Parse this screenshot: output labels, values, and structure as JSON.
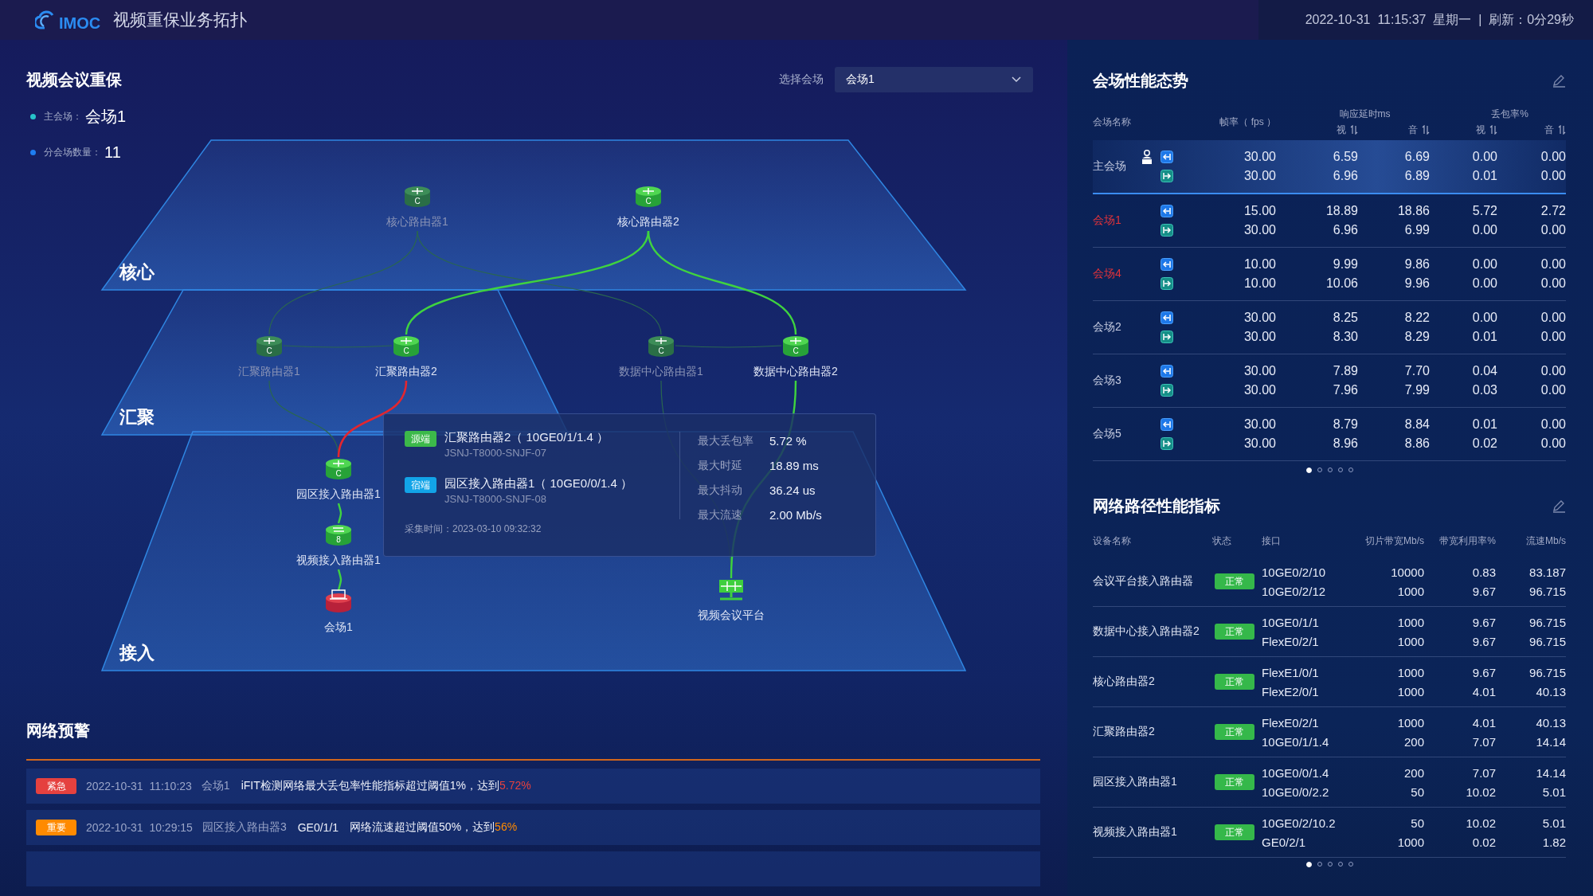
{
  "header": {
    "logo": "IMOC",
    "title": "视频重保业务拓扑",
    "datetime": "2022-10-31  11:15:37  星期一  |  刷新：0分29秒"
  },
  "venue": {
    "title": "视频会议重保",
    "select_label": "选择会场",
    "select_value": "会场1",
    "main_label": "主会场：",
    "main_value": "会场1",
    "count_label": "分会场数量：",
    "count_value": "11"
  },
  "topology": {
    "layers": [
      {
        "name": "核心"
      },
      {
        "name": "汇聚"
      },
      {
        "name": "接入"
      }
    ],
    "nodes": [
      {
        "label": "核心路由器1",
        "kind": "router",
        "badge": "C",
        "highlighted": false
      },
      {
        "label": "核心路由器2",
        "kind": "router",
        "badge": "C",
        "highlighted": true
      },
      {
        "label": "汇聚路由器1",
        "kind": "router",
        "badge": "C",
        "highlighted": false
      },
      {
        "label": "汇聚路由器2",
        "kind": "router",
        "badge": "C",
        "highlighted": true
      },
      {
        "label": "数据中心路由器1",
        "kind": "router",
        "badge": "C",
        "highlighted": false
      },
      {
        "label": "数据中心路由器2",
        "kind": "router",
        "badge": "C",
        "highlighted": true
      },
      {
        "label": "园区接入路由器1",
        "kind": "router",
        "badge": "C",
        "highlighted": true
      },
      {
        "label": "视频接入路由器1",
        "kind": "switch",
        "badge": "8",
        "highlighted": true
      },
      {
        "label": "会场1",
        "kind": "venue",
        "highlighted": true
      },
      {
        "label": "视频会议平台",
        "kind": "platform",
        "highlighted": true
      }
    ],
    "links": [
      {
        "highlighted": false,
        "alarm": false
      },
      {
        "highlighted": false,
        "alarm": false
      },
      {
        "highlighted": true,
        "alarm": false
      },
      {
        "highlighted": true,
        "alarm": false
      },
      {
        "highlighted": false,
        "alarm": false
      },
      {
        "highlighted": false,
        "alarm": false
      },
      {
        "highlighted": false,
        "alarm": false
      },
      {
        "highlighted": true,
        "alarm": true
      },
      {
        "highlighted": true,
        "alarm": false
      },
      {
        "highlighted": true,
        "alarm": false
      },
      {
        "highlighted": false,
        "alarm": false
      },
      {
        "highlighted": true,
        "alarm": false
      }
    ],
    "tooltip": {
      "endpoints": [
        {
          "kind": "source",
          "tag": "源端",
          "name": "汇聚路由器2（ 10GE0/1/1.4 ）",
          "device": "JSNJ-T8000-SNJF-07"
        },
        {
          "kind": "sink",
          "tag": "宿端",
          "name": "园区接入路由器1（ 10GE0/0/1.4 ）",
          "device": "JSNJ-T8000-SNJF-08"
        }
      ],
      "time": "采集时间：2023-03-10 09:32:32",
      "metrics": [
        {
          "label": "最大丢包率",
          "value": "5.72 %"
        },
        {
          "label": "最大时延",
          "value": "18.89 ms"
        },
        {
          "label": "最大抖动",
          "value": "36.24 us"
        },
        {
          "label": "最大流速",
          "value": "2.00 Mb/s"
        }
      ]
    }
  },
  "alerts": {
    "title": "网络预警",
    "items": [
      {
        "urgent": true,
        "tag": "紧急",
        "time": "2022-10-31  11:10:23",
        "source": "会场1",
        "message": "iFIT检测网络最大丢包率性能指标超过阈值1%，达到",
        "value": "5.72%"
      },
      {
        "urgent": false,
        "tag": "重要",
        "time": "2022-10-31  10:29:15",
        "source": "园区接入路由器3",
        "port": "GE0/1/1",
        "message": "网络流速超过阈值50%，达到",
        "value": "56%"
      }
    ]
  },
  "performance": {
    "title": "会场性能态势",
    "columns": {
      "name": "会场名称",
      "fps": "帧率（ fps ）",
      "latency": "响应延时ms",
      "loss": "丢包率%",
      "sub": [
        "视",
        "音",
        "视",
        "音"
      ]
    },
    "rows": [
      {
        "name": "主会场",
        "host": true,
        "alert": false,
        "selected": true,
        "in": [
          "30.00",
          "6.59",
          "6.69",
          "0.00",
          "0.00"
        ],
        "out": [
          "30.00",
          "6.96",
          "6.89",
          "0.01",
          "0.00"
        ]
      },
      {
        "name": "会场1",
        "host": false,
        "alert": true,
        "selected": false,
        "in": [
          "15.00",
          "18.89",
          "18.86",
          "5.72",
          "2.72"
        ],
        "out": [
          "30.00",
          "6.96",
          "6.99",
          "0.00",
          "0.00"
        ]
      },
      {
        "name": "会场4",
        "host": false,
        "alert": true,
        "selected": false,
        "in": [
          "10.00",
          "9.99",
          "9.86",
          "0.00",
          "0.00"
        ],
        "out": [
          "10.00",
          "10.06",
          "9.96",
          "0.00",
          "0.00"
        ]
      },
      {
        "name": "会场2",
        "host": false,
        "alert": false,
        "selected": false,
        "in": [
          "30.00",
          "8.25",
          "8.22",
          "0.00",
          "0.00"
        ],
        "out": [
          "30.00",
          "8.30",
          "8.29",
          "0.01",
          "0.00"
        ]
      },
      {
        "name": "会场3",
        "host": false,
        "alert": false,
        "selected": false,
        "in": [
          "30.00",
          "7.89",
          "7.70",
          "0.04",
          "0.00"
        ],
        "out": [
          "30.00",
          "7.96",
          "7.99",
          "0.03",
          "0.00"
        ]
      },
      {
        "name": "会场5",
        "host": false,
        "alert": false,
        "selected": false,
        "in": [
          "30.00",
          "8.79",
          "8.84",
          "0.01",
          "0.00"
        ],
        "out": [
          "30.00",
          "8.96",
          "8.86",
          "0.02",
          "0.00"
        ]
      }
    ],
    "pages": [
      {
        "selected": true
      },
      {
        "selected": false
      },
      {
        "selected": false
      },
      {
        "selected": false
      },
      {
        "selected": false
      }
    ]
  },
  "paths": {
    "title": "网络路径性能指标",
    "columns": [
      "设备名称",
      "状态",
      "接口",
      "切片带宽Mb/s",
      "带宽利用率%",
      "流速Mb/s"
    ],
    "rows": [
      {
        "device": "会议平台接入路由器",
        "status": "正常",
        "links": [
          [
            "10GE0/2/10",
            "10000",
            "0.83",
            "83.187"
          ],
          [
            "10GE0/2/12",
            "1000",
            "9.67",
            "96.715"
          ]
        ]
      },
      {
        "device": "数据中心接入路由器2",
        "status": "正常",
        "links": [
          [
            "10GE0/1/1",
            "1000",
            "9.67",
            "96.715"
          ],
          [
            "FlexE0/2/1",
            "1000",
            "9.67",
            "96.715"
          ]
        ]
      },
      {
        "device": "核心路由器2",
        "status": "正常",
        "links": [
          [
            "FlexE1/0/1",
            "1000",
            "9.67",
            "96.715"
          ],
          [
            "FlexE2/0/1",
            "1000",
            "4.01",
            "40.13"
          ]
        ]
      },
      {
        "device": "汇聚路由器2",
        "status": "正常",
        "links": [
          [
            "FlexE0/2/1",
            "1000",
            "4.01",
            "40.13"
          ],
          [
            "10GE0/1/1.4",
            "200",
            "7.07",
            "14.14"
          ]
        ]
      },
      {
        "device": "园区接入路由器1",
        "status": "正常",
        "links": [
          [
            "10GE0/0/1.4",
            "200",
            "7.07",
            "14.14"
          ],
          [
            "10GE0/0/2.2",
            "50",
            "10.02",
            "5.01"
          ]
        ]
      },
      {
        "device": "视频接入路由器1",
        "status": "正常",
        "links": [
          [
            "10GE0/2/10.2",
            "50",
            "10.02",
            "5.01"
          ],
          [
            "GE0/2/1",
            "1000",
            "0.02",
            "1.82"
          ]
        ]
      }
    ],
    "pages": [
      {
        "selected": true
      },
      {
        "selected": false
      },
      {
        "selected": false
      },
      {
        "selected": false
      },
      {
        "selected": false
      }
    ]
  }
}
